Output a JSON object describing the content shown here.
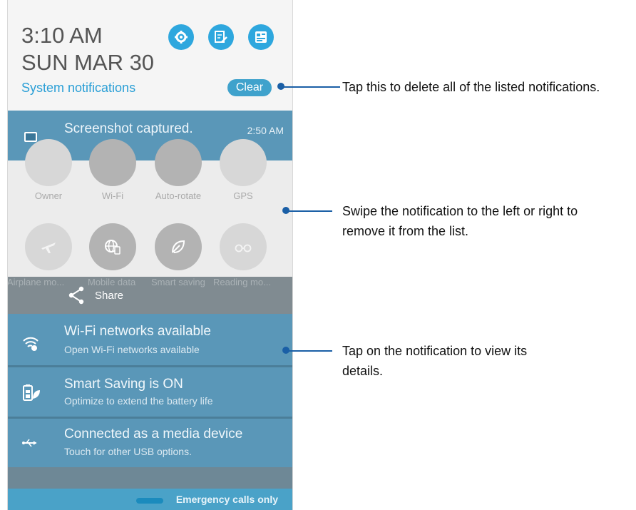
{
  "header": {
    "time": "3:10 AM",
    "date": "SUN MAR 30",
    "system_notifications": "System notifications",
    "clear_label": "Clear",
    "quick_buttons": [
      "settings-icon",
      "edit-icon",
      "profile-icon"
    ]
  },
  "screenshot_notification": {
    "title": "Screenshot captured.",
    "time": "2:50 AM"
  },
  "quick_settings": {
    "row1": [
      "Owner",
      "Wi-Fi",
      "Auto-rotate",
      "GPS"
    ],
    "row2": [
      "Airplane mo...",
      "Mobile data",
      "Smart saving",
      "Reading mo..."
    ]
  },
  "share": {
    "label": "Share"
  },
  "notifications": [
    {
      "title": "Wi-Fi networks available",
      "subtitle": "Open Wi-Fi networks available",
      "icon": "wifi-icon"
    },
    {
      "title": "Smart Saving is ON",
      "subtitle": "Optimize to extend the battery life",
      "icon": "battery-leaf-icon"
    },
    {
      "title": "Connected as a media device",
      "subtitle": "Touch for other USB options.",
      "icon": "usb-icon"
    }
  ],
  "status": {
    "emergency": "Emergency calls only"
  },
  "callouts": [
    "Tap this to delete all of the listed notifications.",
    "Swipe the notification to the left or right to remove it from the list.",
    "Tap on the notification to view its details."
  ],
  "colors": {
    "accent": "#2ea7de",
    "notification_bg": "#5a97b8",
    "callout": "#1a5fa6"
  }
}
